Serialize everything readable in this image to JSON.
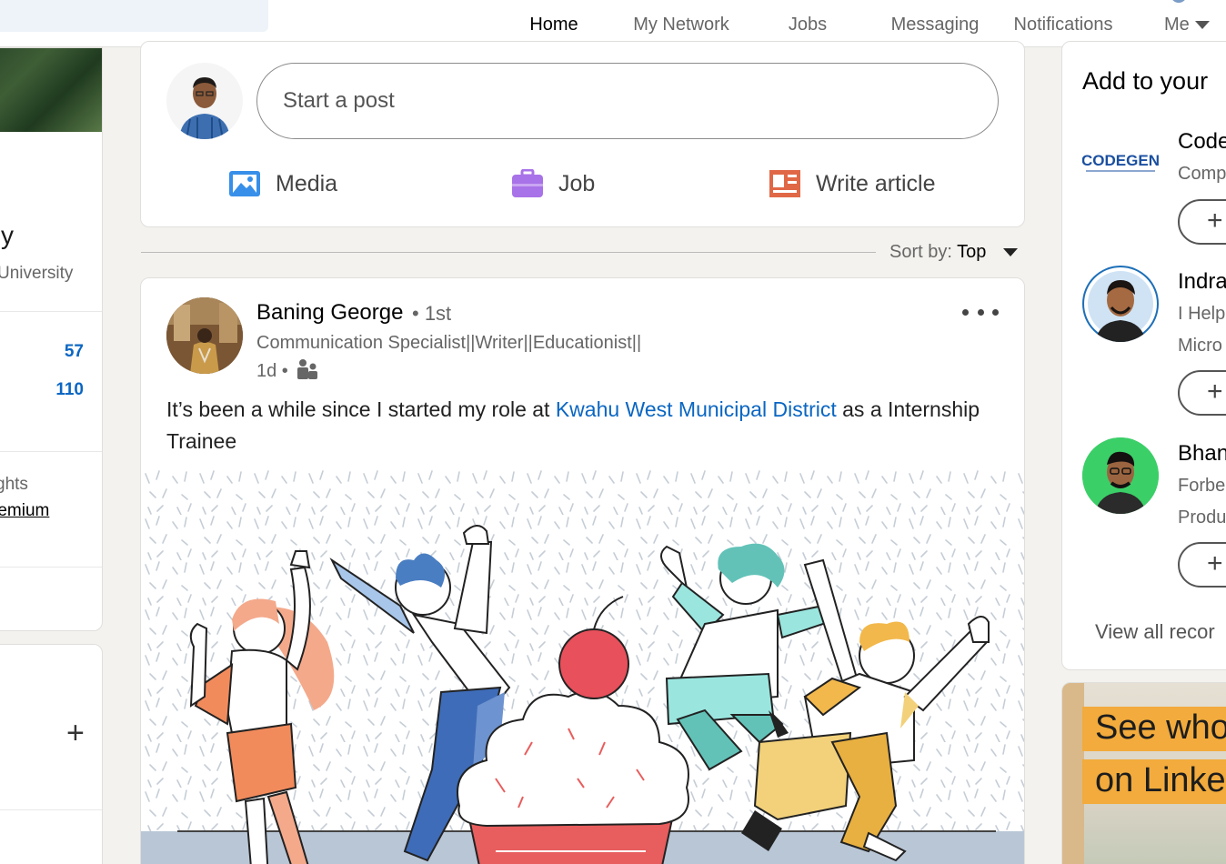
{
  "nav": {
    "items": [
      {
        "label": "Home",
        "icon": "home-icon",
        "active": true
      },
      {
        "label": "My Network",
        "icon": "network-icon",
        "active": false
      },
      {
        "label": "Jobs",
        "icon": "briefcase-icon",
        "active": false
      },
      {
        "label": "Messaging",
        "icon": "messaging-icon",
        "active": false
      },
      {
        "label": "Notifications",
        "icon": "bell-icon",
        "active": false
      },
      {
        "label": "Me",
        "icon": "avatar-icon",
        "active": false
      }
    ]
  },
  "left": {
    "name_fragment": "y",
    "university_fragment": "University",
    "stats": [
      {
        "value": "57"
      },
      {
        "value": "110"
      }
    ],
    "insight_fragment": "ghts",
    "premium_fragment": "remium"
  },
  "composer": {
    "placeholder": "Start a post",
    "actions": [
      {
        "label": "Media",
        "icon": "media-icon",
        "color": "#378fe9"
      },
      {
        "label": "Job",
        "icon": "job-icon",
        "color": "#a872e8"
      },
      {
        "label": "Write article",
        "icon": "article-icon",
        "color": "#e06847"
      }
    ]
  },
  "sort": {
    "prefix": "Sort by:",
    "value": "Top"
  },
  "post": {
    "author": "Baning George",
    "degree": "• 1st",
    "headline": "Communication Specialist||Writer||Educationist||",
    "time": "1d •",
    "text_before": "It’s been a while since I started my role at ",
    "link_text": "Kwahu West Municipal District",
    "text_after": " as a Internship Trainee"
  },
  "right": {
    "title": "Add to your",
    "suggestions": [
      {
        "name": "Code",
        "sub1": "Comp",
        "sub2": "",
        "logo_text": "CODEGEN"
      },
      {
        "name": "Indra",
        "sub1": "I Help",
        "sub2": "Micro"
      },
      {
        "name": "Bhan",
        "sub1": "Forbe",
        "sub2": "Produ"
      }
    ],
    "follow_symbol": "+",
    "view_all": "View all recor"
  },
  "ad": {
    "line1": "See who",
    "line2": "on Linke"
  },
  "colors": {
    "accent": "#0a66c2",
    "background": "#f4f2ee"
  }
}
